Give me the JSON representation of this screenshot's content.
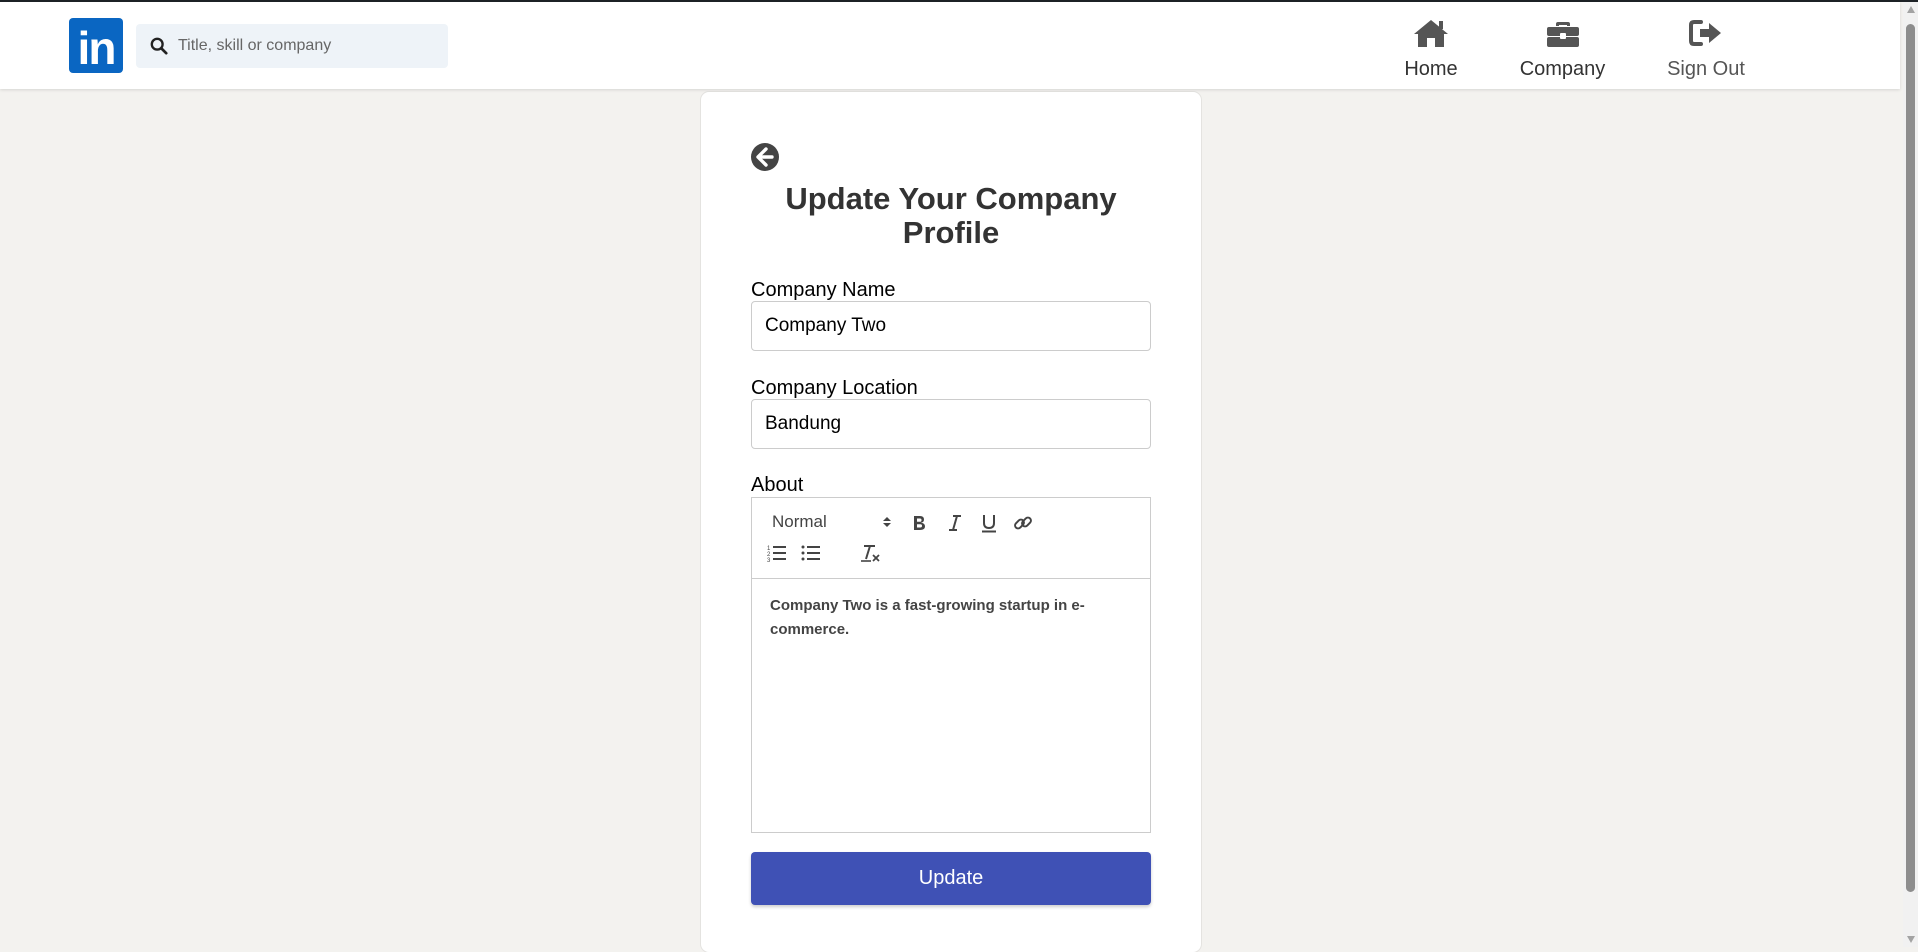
{
  "header": {
    "logo_text": "in",
    "search": {
      "placeholder": "Title, skill or company",
      "value": ""
    },
    "nav": {
      "home": "Home",
      "company": "Company",
      "signout": "Sign Out"
    }
  },
  "form": {
    "title": "Update Your Company Profile",
    "company_name": {
      "label": "Company Name",
      "value": "Company Two"
    },
    "company_location": {
      "label": "Company Location",
      "value": "Bandung"
    },
    "about": {
      "label": "About",
      "header_select": "Normal",
      "content": "Company Two is a fast-growing startup in e-commerce."
    },
    "submit_label": "Update"
  },
  "icons": {
    "back": "arrow-circle-left-icon",
    "search": "search-icon",
    "home": "home-icon",
    "company": "briefcase-icon",
    "signout": "sign-out-icon"
  },
  "colors": {
    "brand": "#0a66c2",
    "primary_button": "#3f51b5",
    "page_background": "#f3f2ef",
    "search_background": "#eef3f8"
  }
}
